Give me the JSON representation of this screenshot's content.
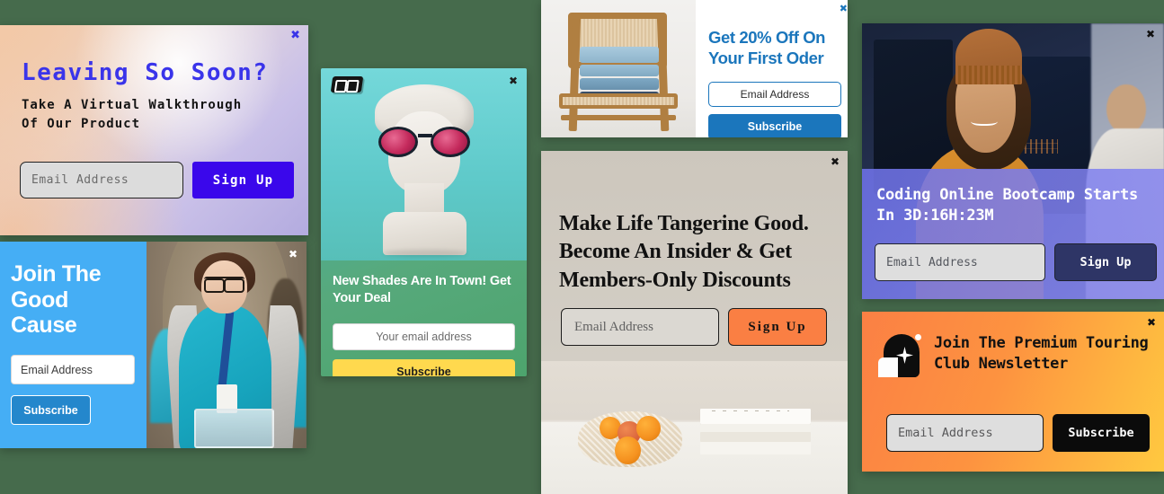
{
  "page": {
    "background_color": "#466b4c",
    "close_icon": "✖"
  },
  "popups": [
    {
      "id": "leaving-so-soon",
      "title": "Leaving So Soon?",
      "subtitle": "Take A Virtual Walkthrough Of Our Product",
      "email_placeholder": "Email Address",
      "button_label": "Sign Up",
      "accent_color": "#3a34ea",
      "button_color": "#3a07eb",
      "close_icon": "✖"
    },
    {
      "id": "join-the-good-cause",
      "title": "Join The Good Cause",
      "email_placeholder": "Email Address",
      "button_label": "Subscribe",
      "accent_color": "#45aef5",
      "button_color": "#2487cc",
      "close_icon": "✖",
      "image_alt": "smiling volunteer in teal shirt"
    },
    {
      "id": "new-shades",
      "title": "New Shades Are In Town! Get Your Deal",
      "email_placeholder": "Your email address",
      "button_label": "Subscribe",
      "accent_color": "#3fb2b5",
      "button_color": "#ffd94e",
      "close_icon": "✖",
      "logo_name": "brand-logo-icon",
      "image_alt": "classical bust wearing pink sunglasses"
    },
    {
      "id": "get-20-percent-off",
      "title": "Get 20% Off On Your First Oder",
      "email_placeholder": "Email Address",
      "button_label": "Subscribe",
      "accent_color": "#1b76bc",
      "button_color": "#1b76bc",
      "close_icon": "✖",
      "image_alt": "folded denim jeans stacked on a wooden chair"
    },
    {
      "id": "make-life-tangerine-good",
      "title": "Make Life Tangerine Good. Become An Insider & Get Members-Only Discounts",
      "email_placeholder": "Email Address",
      "button_label": "Sign Up",
      "accent_color": "#fa7f43",
      "button_color": "#fa7f43",
      "close_icon": "✖",
      "image_alt": "oranges in a mesh bag beside a stack of white books"
    },
    {
      "id": "coding-online-bootcamp",
      "title": "Coding Online Bootcamp Starts In 3D:16H:23M",
      "countdown": "3D:16H:23M",
      "email_placeholder": "Email Address",
      "button_label": "Sign Up",
      "accent_color": "#6e72e8",
      "button_color": "#2e3566",
      "close_icon": "✖",
      "image_alt": "smiling student in beanie in front of trading monitors"
    },
    {
      "id": "premium-touring-club",
      "title": "Join The Premium Touring Club Newsletter",
      "email_placeholder": "Email Address",
      "button_label": "Subscribe",
      "accent_color": "#fb8044",
      "button_color": "#0b0b0b",
      "close_icon": "✖",
      "logo_name": "touring-club-logo-icon"
    }
  ]
}
